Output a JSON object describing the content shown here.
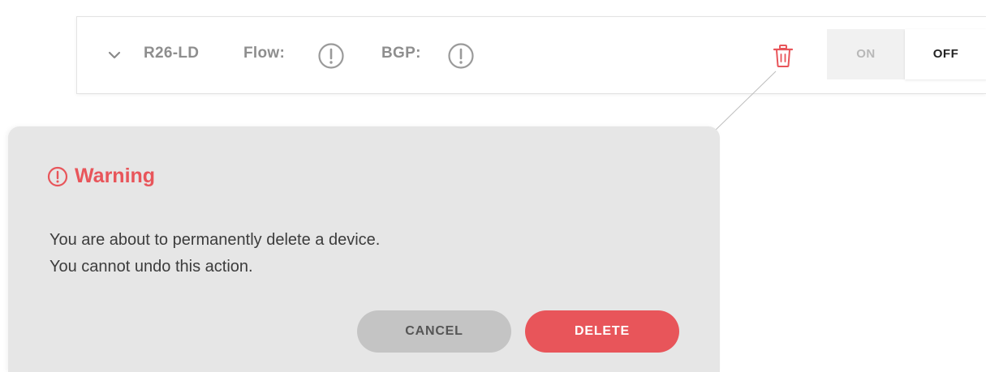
{
  "device": {
    "name": "R26-LD",
    "flow_label": "Flow:",
    "bgp_label": "BGP:",
    "toggle_on_label": "ON",
    "toggle_off_label": "OFF",
    "toggle_state": "OFF"
  },
  "dialog": {
    "title": "Warning",
    "message_line1": "You are about to permanently delete a device.",
    "message_line2": "You cannot undo this action.",
    "cancel_label": "CANCEL",
    "delete_label": "DELETE"
  },
  "icons": {
    "chevron": "chevron-down-icon",
    "flow_status": "alert-circle-icon",
    "bgp_status": "alert-circle-icon",
    "delete": "trash-icon",
    "warning": "alert-circle-icon"
  },
  "colors": {
    "danger": "#e8555a",
    "muted_text": "#8e8e8e",
    "dialog_background": "#e6e6e6",
    "cancel_background": "#c4c4c4"
  }
}
